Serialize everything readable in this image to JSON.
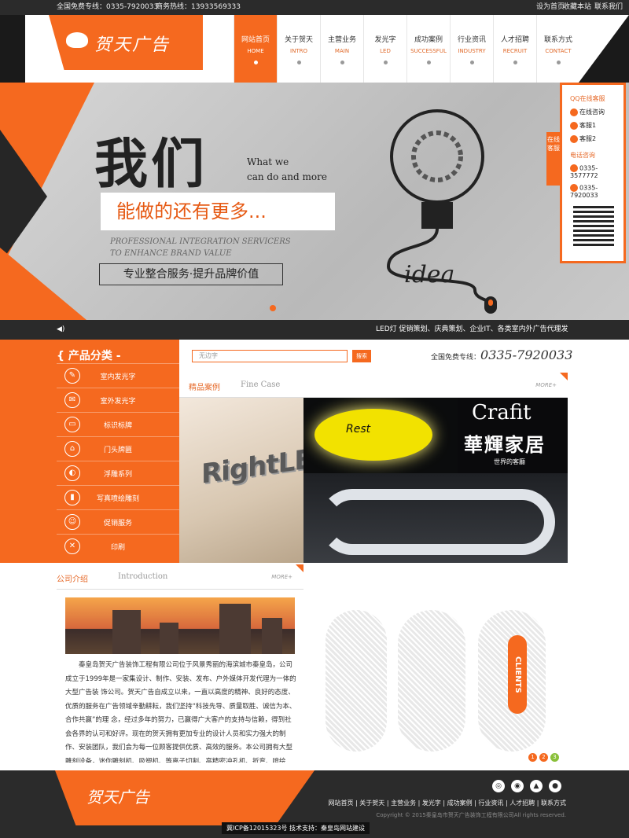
{
  "topbar": {
    "free_line": "全国免费专线：0335-7920033",
    "biz_line": "商务热线：13933569333",
    "set_home": "设为首页",
    "favorite": "收藏本站",
    "contact": "联系我们"
  },
  "logo": {
    "text": "贺天广告"
  },
  "nav": [
    {
      "cn": "网站首页",
      "en": "HOME"
    },
    {
      "cn": "关于贺天",
      "en": "INTRO"
    },
    {
      "cn": "主营业务",
      "en": "MAIN"
    },
    {
      "cn": "发光字",
      "en": "LED"
    },
    {
      "cn": "成功案例",
      "en": "SUCCESSFUL"
    },
    {
      "cn": "行业资讯",
      "en": "INDUSTRY"
    },
    {
      "cn": "人才招聘",
      "en": "RECRUIT"
    },
    {
      "cn": "联系方式",
      "en": "CONTACT"
    }
  ],
  "banner": {
    "big": "我们",
    "what1": "What we",
    "what2": "can do and more",
    "more": "能做的还有更多...",
    "prof1": "PROFESSIONAL INTEGRATION SERVICERS",
    "prof2": "TO ENHANCE BRAND VALUE",
    "box": "专业整合服务·提升品牌价值",
    "bulb_word": "idea"
  },
  "kefu": {
    "tab": "在线客服",
    "qq_title": "QQ在线客服",
    "online": "在线咨询",
    "kf1": "客服1",
    "kf2": "客服2",
    "tel_title": "电话咨询",
    "tel1": "0335-3577772",
    "tel2": "0335-7920033"
  },
  "ticker": {
    "text": "LED灯 促销策划、庆典策划、企业IT、各类室内外广告代理发"
  },
  "categories": {
    "title": "{ 产品分类 -",
    "items": [
      "室内发光字",
      "室外发光字",
      "标识标牌",
      "门头牌匾",
      "浮雕系列",
      "写真喷绘雕刻",
      "促销服务",
      "印刷"
    ]
  },
  "search": {
    "placeholder": "无边字",
    "button": "搜索"
  },
  "hotline": {
    "label": "全国免费专线：",
    "number": "0335-7920033"
  },
  "cases": {
    "title": "精品案例",
    "en": "Fine Case",
    "more": "MORE+"
  },
  "photos": {
    "p1": "RightLED",
    "p2": "Rest",
    "p3a": "Crafit",
    "p3b": "華輝家居",
    "p3c": "世界的客廳"
  },
  "about": {
    "title": "公司介绍",
    "en": "Introduction",
    "more": "MORE+",
    "text": "秦皇岛贺天广告装饰工程有限公司位于风景秀丽的海滨城市秦皇岛，公司成立于1999年是一家集设计、制作、安装、发布、户外媒体开发代理为一体的大型广告装 饰公司。贺天广告自成立以来，一直以高度的精神、良好的态度、优质的服务在广告领域辛勤耕耘，我们坚持“科技先导、质量取胜、诚信为本、合作共赢”的理 念，经过多年的努力，已赢得广大客户的支持与信赖，得到社会各界的认可和好评。现在的贺天拥有更加专业的设计人员和实力强大的制作、安装团队，我们会为每一位顾客提供优质、高效的服务。本公司拥有大型雕刻设备，迷你雕刻机、吸塑机、等离子切割、高精密冲孔机、折弯、喷绘机、写真机等，专"
  },
  "clients": {
    "badge": "CLIENTS"
  },
  "pager": [
    "1",
    "2",
    "3"
  ],
  "footer": {
    "logo": "贺天广告",
    "links": "网站首页 | 关于贺天 | 主营业务 | 发光字 | 成功案例 | 行业资讯 | 人才招聘 | 联系方式",
    "copy": "Copyright © 2015秦皇岛市贺天广告装饰工程有限公司All rights reserved.",
    "icp": "冀ICP备12015323号  技术支持：秦皇岛网站建设"
  },
  "colors": {
    "accent": "#f5691f",
    "dark": "#2b2b2b"
  }
}
